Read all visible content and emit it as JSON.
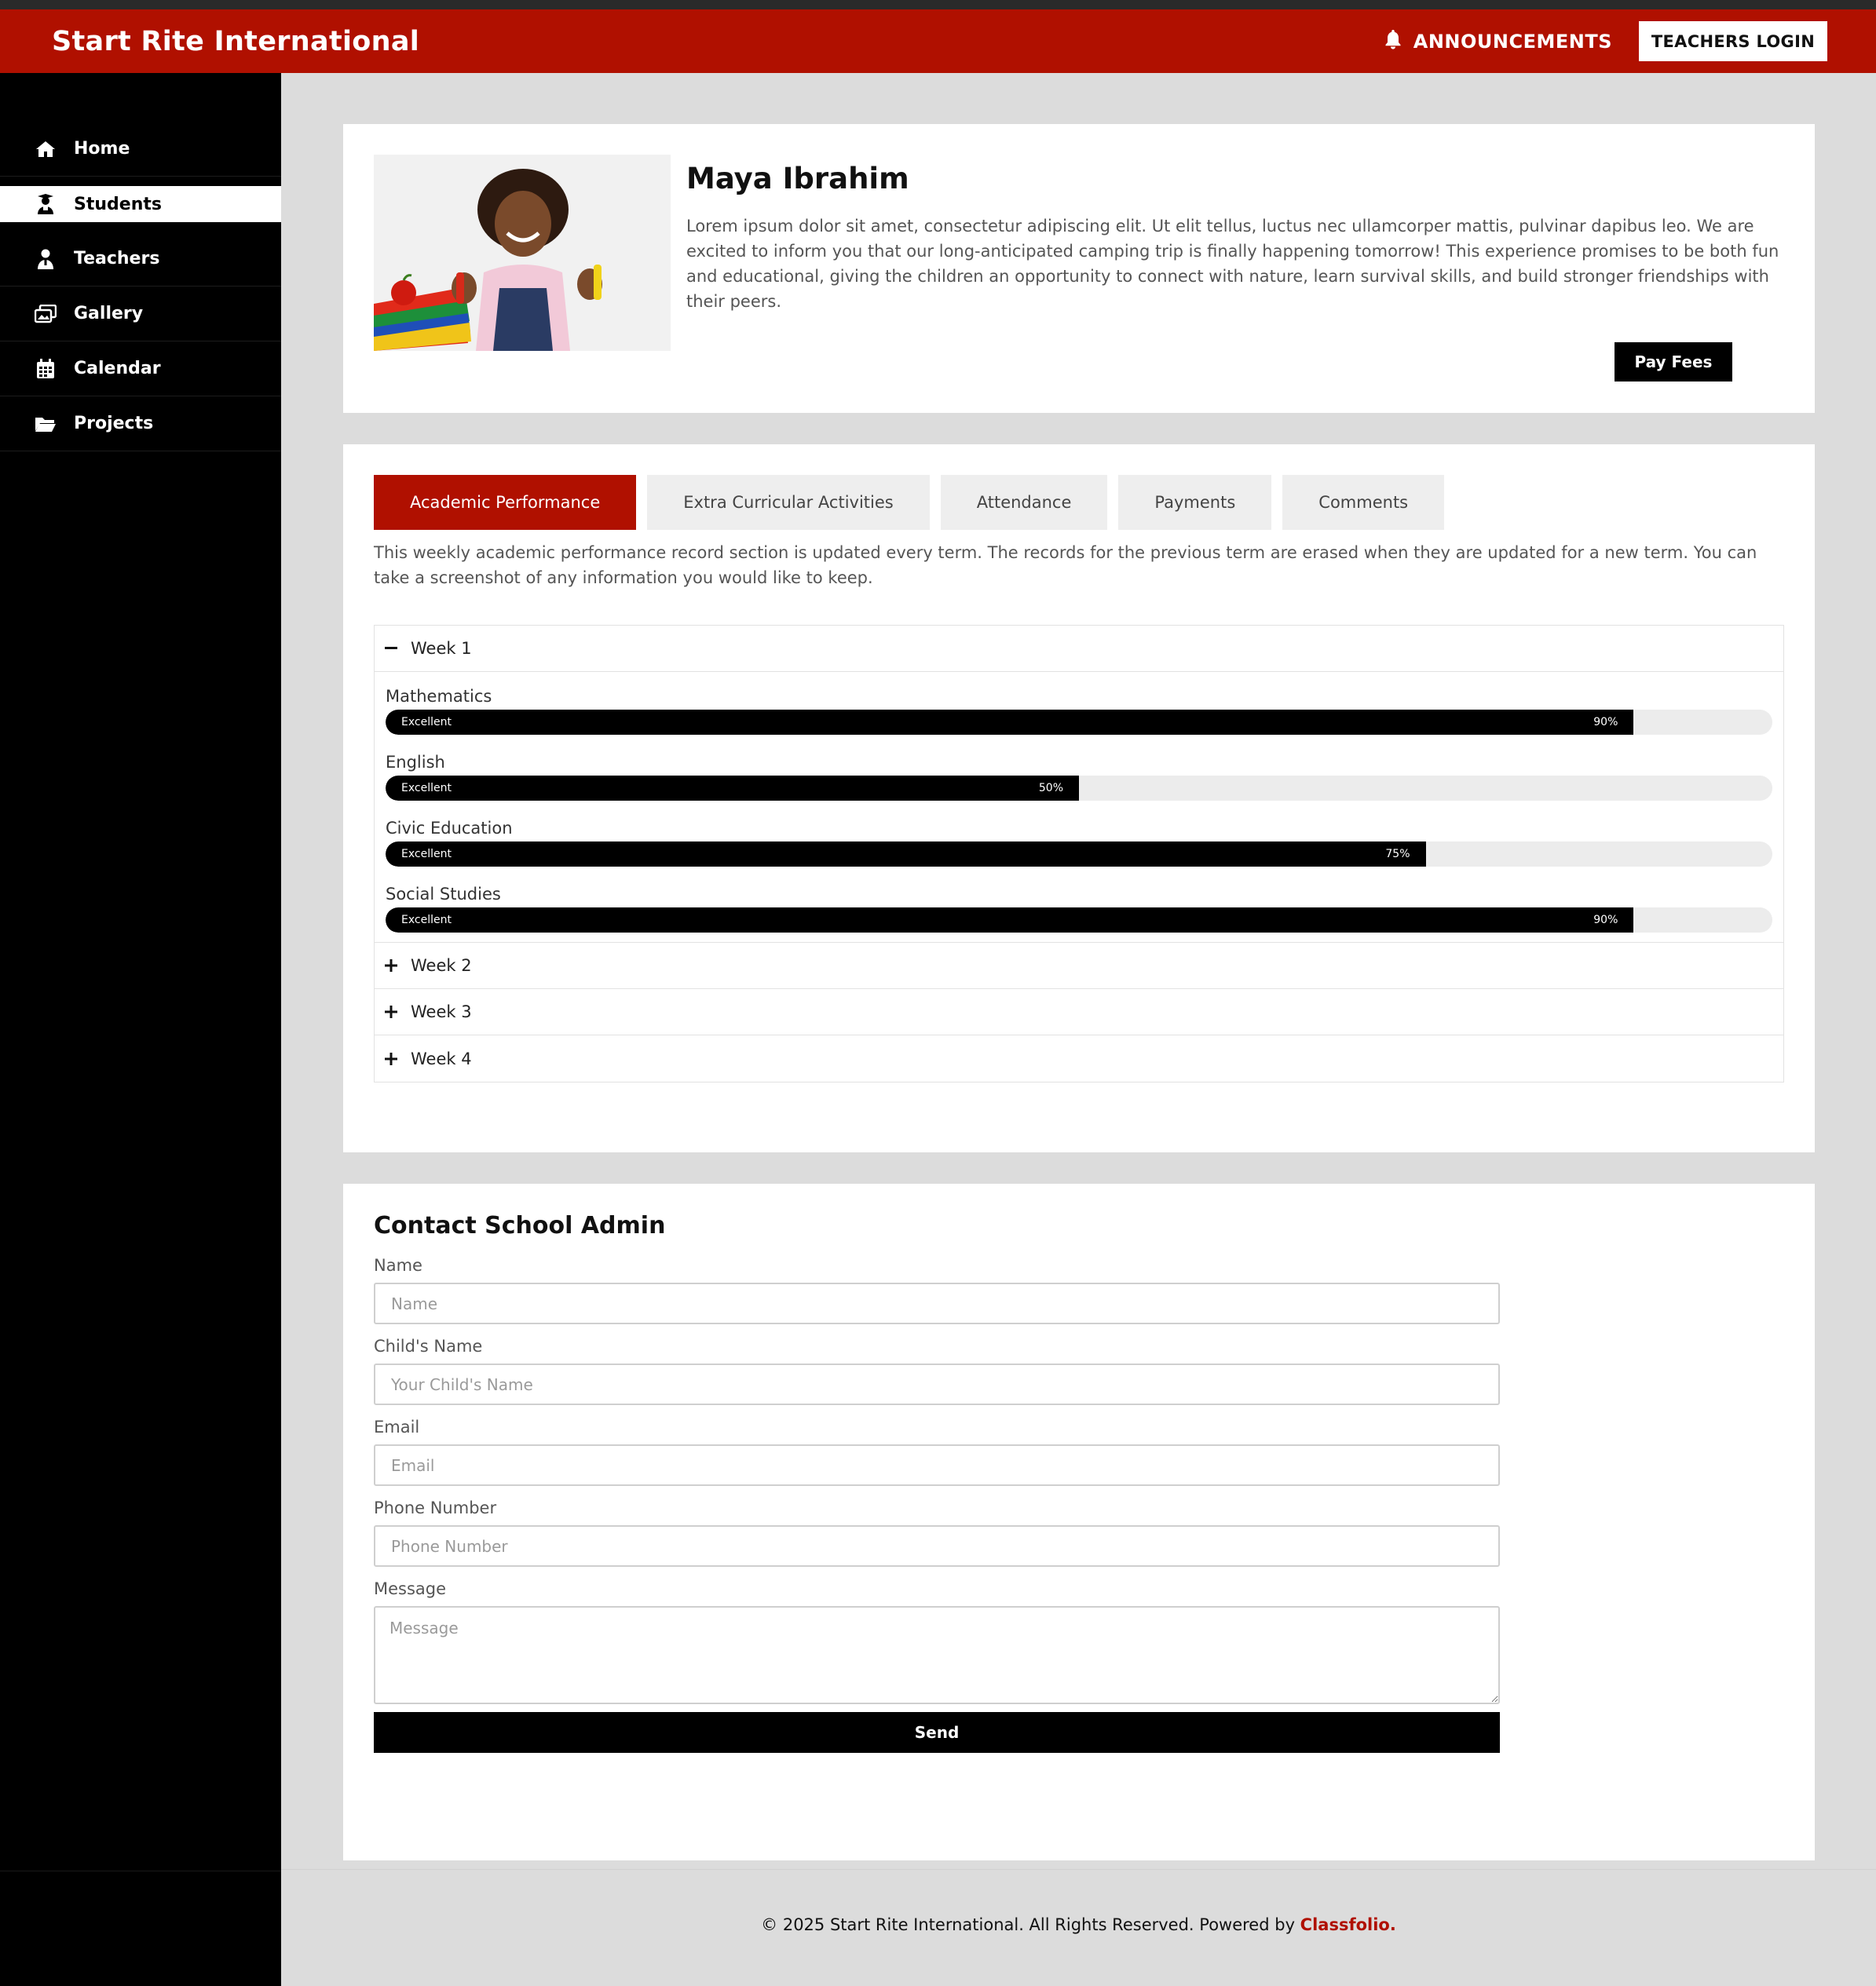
{
  "header": {
    "brand": "Start Rite International",
    "announcements_label": "ANNOUNCEMENTS",
    "teachers_login_label": "TEACHERS LOGIN"
  },
  "sidebar": {
    "items": [
      {
        "label": "Home",
        "icon": "home-icon"
      },
      {
        "label": "Students",
        "icon": "student-icon",
        "active": true
      },
      {
        "label": "Teachers",
        "icon": "teacher-icon"
      },
      {
        "label": "Gallery",
        "icon": "gallery-icon"
      },
      {
        "label": "Calendar",
        "icon": "calendar-icon"
      },
      {
        "label": "Projects",
        "icon": "folder-icon"
      }
    ]
  },
  "profile": {
    "name": "Maya Ibrahim",
    "bio": "Lorem ipsum dolor sit amet, consectetur adipiscing elit. Ut elit tellus, luctus nec ullamcorper mattis, pulvinar dapibus leo. We are excited to inform you that our long-anticipated camping trip is finally happening tomorrow! This experience promises to be both fun and educational, giving the children an opportunity to connect with nature, learn survival skills, and build stronger friendships with their peers.",
    "pay_fees_label": "Pay Fees"
  },
  "tabs": [
    {
      "label": "Academic Performance",
      "active": true
    },
    {
      "label": "Extra Curricular Activities"
    },
    {
      "label": "Attendance"
    },
    {
      "label": "Payments"
    },
    {
      "label": "Comments"
    }
  ],
  "performance": {
    "note": "This weekly academic performance record section is updated every term. The records for the previous term are erased when they are updated for a new term. You can take a screenshot of any information you would like to keep.",
    "weeks": [
      {
        "label": "Week 1",
        "expanded": true,
        "subjects": [
          {
            "name": "Mathematics",
            "grade": "Excellent",
            "percent": 90,
            "percent_label": "90%"
          },
          {
            "name": "English",
            "grade": "Excellent",
            "percent": 50,
            "percent_label": "50%"
          },
          {
            "name": "Civic Education",
            "grade": "Excellent",
            "percent": 75,
            "percent_label": "75%"
          },
          {
            "name": "Social Studies",
            "grade": "Excellent",
            "percent": 90,
            "percent_label": "90%"
          }
        ]
      },
      {
        "label": "Week 2",
        "expanded": false
      },
      {
        "label": "Week 3",
        "expanded": false
      },
      {
        "label": "Week 4",
        "expanded": false
      }
    ]
  },
  "contact": {
    "title": "Contact School Admin",
    "fields": {
      "name": {
        "label": "Name",
        "placeholder": "Name"
      },
      "child_name": {
        "label": "Child's Name",
        "placeholder": "Your Child's Name"
      },
      "email": {
        "label": "Email",
        "placeholder": "Email"
      },
      "phone": {
        "label": "Phone Number",
        "placeholder": "Phone Number"
      },
      "message": {
        "label": "Message",
        "placeholder": "Message"
      }
    },
    "send_label": "Send"
  },
  "footer": {
    "text": "© 2025 Start Rite International. All Rights Reserved. Powered by ",
    "powered_by": "Classfolio."
  },
  "colors": {
    "brand_red": "#b01000",
    "sidebar_bg": "#000000",
    "page_bg": "#dcdcdc"
  }
}
